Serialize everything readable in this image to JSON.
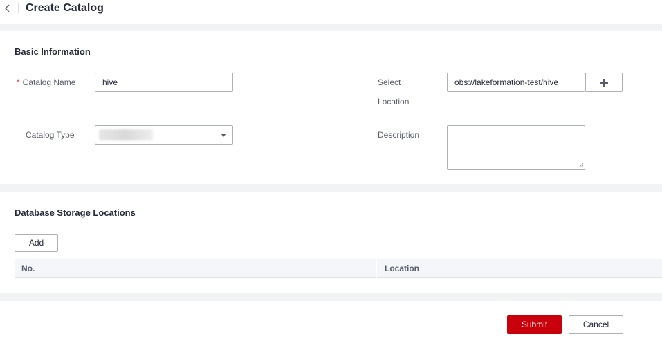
{
  "header": {
    "title": "Create Catalog",
    "back_icon": "chevron-left-icon"
  },
  "basic_info": {
    "title": "Basic Information",
    "catalog_name": {
      "required_mark": "*",
      "label": "Catalog Name",
      "value": "hive"
    },
    "catalog_type": {
      "label": "Catalog Type",
      "value": ""
    },
    "select_location": {
      "label_line1": "Select",
      "label_line2": "Location",
      "value": "obs://lakeformation-test/hive",
      "add_icon": "plus-icon"
    },
    "description": {
      "label": "Description",
      "value": ""
    }
  },
  "storage": {
    "title": "Database Storage Locations",
    "add_label": "Add",
    "columns": [
      "No.",
      "Location"
    ],
    "rows": []
  },
  "footer": {
    "submit_label": "Submit",
    "cancel_label": "Cancel"
  },
  "colors": {
    "primary": "#c7000b",
    "required": "#e54545",
    "page_gap": "#f2f3f5",
    "table_header": "#f5f6fa"
  }
}
